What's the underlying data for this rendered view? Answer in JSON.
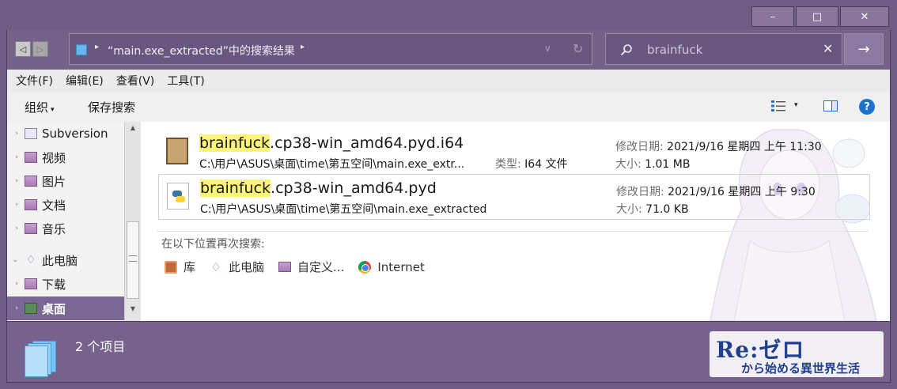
{
  "window": {
    "minimize_label": "–",
    "maximize_label": "□",
    "close_label": "✕"
  },
  "address": {
    "back_label": "◁",
    "forward_label": "▷",
    "arrow": "▸",
    "path_text": "“main.exe_extracted”中的搜索结果",
    "dropdown_glyph": "∨",
    "refresh_glyph": "↻"
  },
  "search": {
    "query": "brainfuck",
    "clear_glyph": "✕",
    "go_glyph": "→"
  },
  "menu": [
    {
      "label": "文件(F)"
    },
    {
      "label": "编辑(E)"
    },
    {
      "label": "查看(V)"
    },
    {
      "label": "工具(T)"
    }
  ],
  "toolbar": {
    "organize_label": "组织",
    "organize_caret": "▾",
    "save_search_label": "保存搜索",
    "view_caret": "▾",
    "help_label": "?"
  },
  "nav": {
    "expand_glyph": "›",
    "expanded_glyph": "⌄",
    "items": [
      {
        "label": "Subversion"
      },
      {
        "label": "视频"
      },
      {
        "label": "图片"
      },
      {
        "label": "文档"
      },
      {
        "label": "音乐"
      },
      {
        "label": "此电脑"
      },
      {
        "label": "下载"
      },
      {
        "label": "桌面"
      }
    ],
    "scroll_up": "▲",
    "scroll_down": "▼"
  },
  "results": [
    {
      "name_highlight": "brainfuck",
      "name_rest": ".cp38-win_amd64.pyd.i64",
      "path": "C:\\用户\\ASUS\\桌面\\time\\第五空间\\main.exe_extr...",
      "type_label": "类型:",
      "type_value": "I64 文件",
      "date_label": "修改日期:",
      "date_value": "2021/9/16 星期四 上午 11:30",
      "size_label": "大小:",
      "size_value": "1.01 MB"
    },
    {
      "name_highlight": "brainfuck",
      "name_rest": ".cp38-win_amd64.pyd",
      "path": "C:\\用户\\ASUS\\桌面\\time\\第五空间\\main.exe_extracted",
      "date_label": "修改日期:",
      "date_value": "2021/9/16 星期四 上午 9:30",
      "size_label": "大小:",
      "size_value": "71.0 KB"
    }
  ],
  "search_again": {
    "label": "在以下位置再次搜索:",
    "locations": [
      {
        "label": "库",
        "icon": "library-icon"
      },
      {
        "label": "此电脑",
        "icon": "computer-icon"
      },
      {
        "label": "自定义...",
        "icon": "folder-icon"
      },
      {
        "label": "Internet",
        "icon": "chrome-icon"
      }
    ]
  },
  "status": {
    "item_count": "2 个项目"
  },
  "logo": {
    "main": "Re:ゼロ",
    "sub": "から始める異世界生活"
  },
  "colors": {
    "window_frame": "#6f5c84",
    "status_bar": "#76628c",
    "selection": "#7b6795",
    "highlight": "#fcf37a"
  }
}
